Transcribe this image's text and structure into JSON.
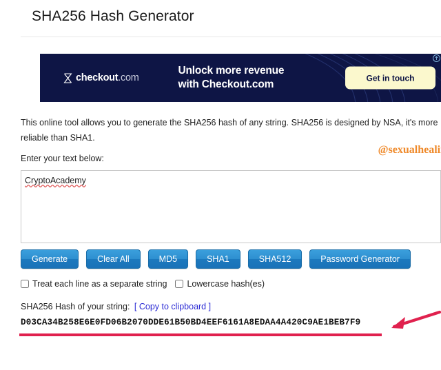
{
  "header": {
    "title": "SHA256 Hash Generator"
  },
  "ad": {
    "logo_name": "checkout",
    "logo_tld": ".com",
    "logo_icon": "checkout-hourglass-icon",
    "headline_line1": "Unlock more revenue",
    "headline_line2": "with Checkout.com",
    "cta_label": "Get in touch",
    "adchoices_icon": "adchoices-icon",
    "background_color": "#0e1545",
    "cta_color": "#fbf8cd"
  },
  "main": {
    "intro": "This online tool allows you to generate the SHA256 hash of any string. SHA256 is designed by NSA, it's more reliable than SHA1.",
    "enter_label": "Enter your text below:",
    "watermark": "@sexualhealing",
    "watermark_color": "#ef8a2b",
    "textarea_value": "CryptoAcademy",
    "textarea_placeholder": "",
    "buttons": [
      {
        "label": "Generate",
        "name": "generate-button"
      },
      {
        "label": "Clear All",
        "name": "clear-all-button"
      },
      {
        "label": "MD5",
        "name": "md5-button"
      },
      {
        "label": "SHA1",
        "name": "sha1-button"
      },
      {
        "label": "SHA512",
        "name": "sha512-button"
      },
      {
        "label": "Password Generator",
        "name": "password-generator-button"
      }
    ],
    "checkboxes": [
      {
        "label": "Treat each line as a separate string",
        "checked": false
      },
      {
        "label": "Lowercase hash(es)",
        "checked": false
      }
    ],
    "result_label": "SHA256 Hash of your string:",
    "copy_link_label": "[ Copy to clipboard ]",
    "hash_value": "D03CA34B258E6E0FD06B2070DDE61B50BD4EEF6161A8EDAA4A420C9AE1BEB7F9",
    "annotation_color": "#e0214e",
    "link_color": "#2b2bd4"
  }
}
